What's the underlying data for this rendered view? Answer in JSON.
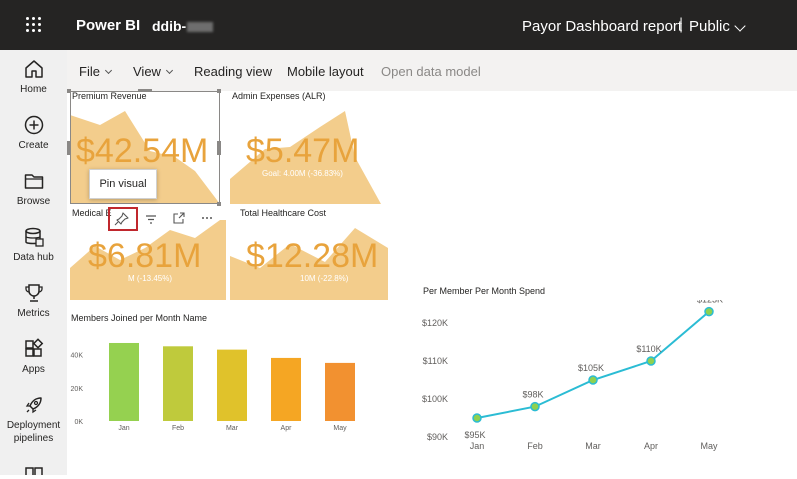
{
  "topbar": {
    "app_name": "Power BI",
    "workspace": "ddib-",
    "report_title": "Payor Dashboard report",
    "separator": "|",
    "sensitivity": "Public",
    "icons": [
      "waffle-icon",
      "chevron-down-icon"
    ]
  },
  "rail": {
    "items": [
      {
        "label": "Home",
        "icon": "home-icon"
      },
      {
        "label": "Create",
        "icon": "plus-circle-icon"
      },
      {
        "label": "Browse",
        "icon": "folder-icon"
      },
      {
        "label": "Data hub",
        "icon": "database-icon"
      },
      {
        "label": "Metrics",
        "icon": "trophy-icon"
      },
      {
        "label": "Apps",
        "icon": "apps-icon"
      },
      {
        "label": "Deployment pipelines",
        "icon": "rocket-icon"
      }
    ]
  },
  "actionbar": {
    "file": "File",
    "view": "View",
    "reading_view": "Reading view",
    "mobile_layout": "Mobile layout",
    "open_data_model": "Open data model"
  },
  "tooltip": "Pin visual",
  "colors": {
    "kpi_value": "#e8a33c",
    "kpi_area": "#f3cd8c",
    "line": "#2bbcd4",
    "point": "#8fd14f",
    "pin_highlight": "#c0272d"
  },
  "kpis": [
    {
      "title": "Premium Revenue",
      "value": "$42.54M",
      "goal": ""
    },
    {
      "title": "Admin Expenses (ALR)",
      "value": "$5.47M",
      "goal": "Goal: 4.00M (-36.83%)"
    },
    {
      "title": "Medical E",
      "value": "$6.81M",
      "goal": "M (-13.45%)"
    },
    {
      "title": "Total Healthcare Cost",
      "value": "$12.28M",
      "goal": "10M (-22.8%)"
    }
  ],
  "chart_data": [
    {
      "type": "bar",
      "title": "Members Joined per Month Name",
      "categories": [
        "Jan",
        "Feb",
        "Mar",
        "Apr",
        "May"
      ],
      "values": [
        47,
        45,
        43,
        38,
        35
      ],
      "ylim": [
        0,
        50
      ],
      "yticks": [
        "0K",
        "20K",
        "40K"
      ],
      "ytick_values": [
        0,
        20,
        40
      ],
      "colors": [
        "#95d150",
        "#bfca3c",
        "#e0c22b",
        "#f5a623",
        "#f29130"
      ],
      "grid": false
    },
    {
      "type": "line",
      "title": "Per Member Per Month Spend",
      "categories": [
        "Jan",
        "Feb",
        "Mar",
        "Apr",
        "May"
      ],
      "values": [
        95,
        98,
        105,
        110,
        123
      ],
      "data_labels": [
        "$95K",
        "$98K",
        "$105K",
        "$110K",
        "$123K"
      ],
      "ylim": [
        90,
        120
      ],
      "yticks": [
        "$90K",
        "$100K",
        "$110K",
        "$120K"
      ],
      "ytick_values": [
        90,
        100,
        110,
        120
      ],
      "grid": false
    }
  ]
}
